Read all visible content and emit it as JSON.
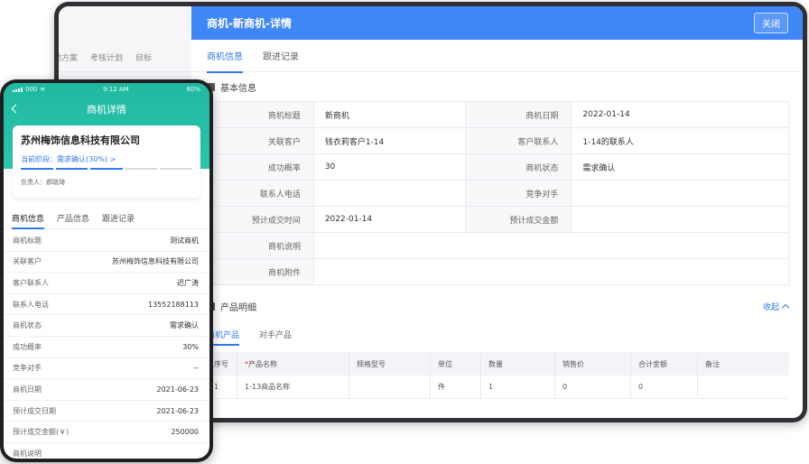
{
  "tablet": {
    "bg_tabs": [
      "动方案",
      "考核计划",
      "目标"
    ],
    "header_title": "商机-新商机-详情",
    "close_label": "关闭",
    "tabs": [
      {
        "label": "商机信息",
        "active": true
      },
      {
        "label": "跟进记录",
        "active": false
      }
    ],
    "basic_section_title": "基本信息",
    "info_rows": [
      {
        "l1": "商机标题",
        "v1": "新商机",
        "l2": "商机日期",
        "v2": "2022-01-14"
      },
      {
        "l1": "关联客户",
        "v1": "钱衣莉客户1-14",
        "l2": "客户联系人",
        "v2": "1-14的联系人"
      },
      {
        "l1": "成功概率",
        "v1": "30",
        "l2": "商机状态",
        "v2": "需求确认"
      },
      {
        "l1": "联系人电话",
        "v1": "",
        "l2": "竞争对手",
        "v2": ""
      },
      {
        "l1": "预计成交时间",
        "v1": "2022-01-14",
        "l2": "预计成交金额",
        "v2": ""
      }
    ],
    "wide_rows": [
      {
        "label": "商机说明",
        "value": ""
      },
      {
        "label": "商机附件",
        "value": ""
      }
    ],
    "product_section_title": "产品明细",
    "collapse_label": "收起",
    "product_tabs": [
      {
        "label": "商机产品",
        "active": true
      },
      {
        "label": "对手产品",
        "active": false
      }
    ],
    "product_columns": [
      "序号",
      "产品名称",
      "规格型号",
      "单位",
      "数量",
      "销售价",
      "合计金额",
      "备注"
    ],
    "product_rows": [
      [
        "1",
        "1-13商品名称",
        "",
        "件",
        "1",
        "0",
        "0",
        ""
      ]
    ]
  },
  "phone": {
    "status": {
      "carrier": "000",
      "time": "9:12 AM",
      "battery": "60%"
    },
    "title": "商机详情",
    "company": "苏州梅饰信息科技有限公司",
    "stage_text": "当前阶段：需求确认(30%) >",
    "leader": "负责人：郝晓琦",
    "tabs": [
      {
        "label": "商机信息",
        "active": true
      },
      {
        "label": "产品信息",
        "active": false
      },
      {
        "label": "跟进记录",
        "active": false
      }
    ],
    "fields": [
      {
        "k": "商机标题",
        "v": "测试商机"
      },
      {
        "k": "关联客户",
        "v": "苏州梅饰信息科技有限公司"
      },
      {
        "k": "客户联系人",
        "v": "迟广涛"
      },
      {
        "k": "联系人电话",
        "v": "13552188113"
      },
      {
        "k": "商机状态",
        "v": "需求确认"
      },
      {
        "k": "成功概率",
        "v": "30%"
      },
      {
        "k": "竞争对手",
        "v": "--"
      },
      {
        "k": "商机日期",
        "v": "2021-06-23"
      },
      {
        "k": "预计成交日期",
        "v": "2021-06-23"
      },
      {
        "k": "预计成交金额(￥)",
        "v": "250000"
      },
      {
        "k": "商机说明",
        "v": ""
      }
    ]
  }
}
